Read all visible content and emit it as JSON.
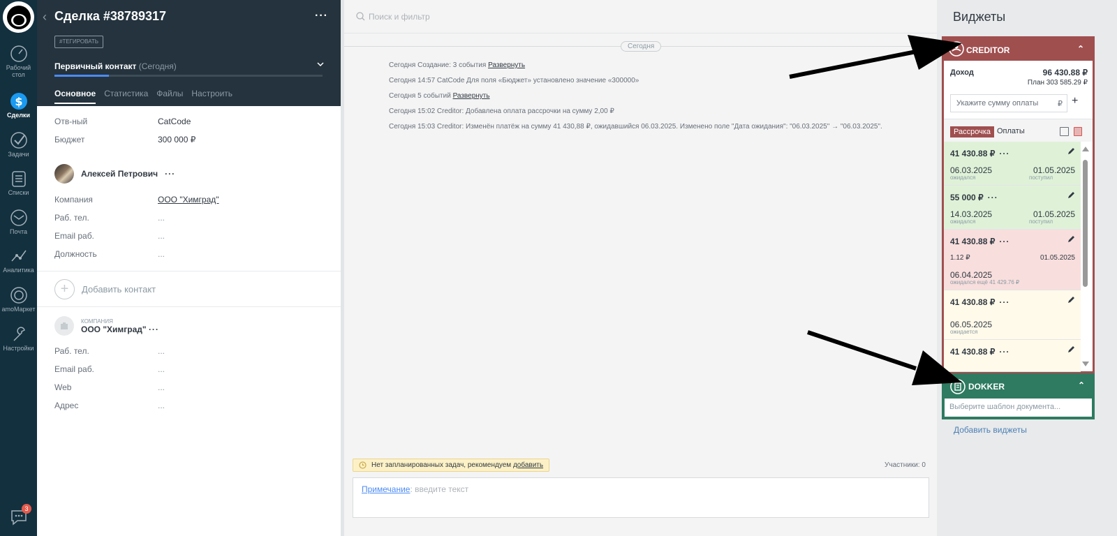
{
  "nav": {
    "items": [
      {
        "label": "Рабочий стол",
        "icon": "dashboard-icon"
      },
      {
        "label": "Сделки",
        "icon": "deals-icon"
      },
      {
        "label": "Задачи",
        "icon": "tasks-icon"
      },
      {
        "label": "Списки",
        "icon": "lists-icon"
      },
      {
        "label": "Почта",
        "icon": "mail-icon"
      },
      {
        "label": "Аналитика",
        "icon": "analytics-icon"
      },
      {
        "label": "amoМаркет",
        "icon": "market-icon"
      },
      {
        "label": "Настройки",
        "icon": "settings-icon"
      }
    ],
    "chat_badge": "3"
  },
  "deal": {
    "title": "Сделка #38789317",
    "tag_button": "#ТЕГИРОВАТЬ",
    "pipeline_stage": "Первичный контакт",
    "stage_date": "(Сегодня)",
    "tabs": [
      "Основное",
      "Статистика",
      "Файлы",
      "Настроить"
    ],
    "fields": [
      {
        "label": "Отв-ный",
        "value": "CatCode"
      },
      {
        "label": "Бюджет",
        "value": "300 000  ₽"
      }
    ],
    "contact": {
      "name": "Алексей Петрович",
      "fields": [
        {
          "label": "Компания",
          "value": "ООО \"Химград\""
        },
        {
          "label": "Раб. тел.",
          "value": "..."
        },
        {
          "label": "Email раб.",
          "value": "..."
        },
        {
          "label": "Должность",
          "value": "..."
        }
      ]
    },
    "add_contact": "Добавить контакт",
    "company": {
      "caption": "компания",
      "name": "ООО \"Химград\"",
      "fields": [
        {
          "label": "Раб. тел.",
          "value": "..."
        },
        {
          "label": "Email раб.",
          "value": "..."
        },
        {
          "label": "Web",
          "value": "..."
        },
        {
          "label": "Адрес",
          "value": "..."
        }
      ]
    }
  },
  "feed": {
    "search_placeholder": "Поиск и фильтр",
    "day_label": "Сегодня",
    "events": [
      {
        "text": "Сегодня Создание: 3 события ",
        "link": "Развернуть"
      },
      {
        "text": "Сегодня 14:57 CatCode Для поля «Бюджет» установлено значение «300000»",
        "link": ""
      },
      {
        "text": "Сегодня 5 событий ",
        "link": "Развернуть"
      },
      {
        "text": "Сегодня 15:02 Creditor: Добавлена оплата рассрочки на сумму 2,00 ₽",
        "link": ""
      },
      {
        "text": "Сегодня 15:03 Creditor: Изменён платёж на сумму 41 430,88 ₽, ожидавшийся 06.03.2025. Изменено поле \"Дата ожидания\": \"06.03.2025\" → \"06.03.2025\".",
        "link": ""
      }
    ],
    "no_tasks": "Нет запланированных задач, рекомендуем ",
    "no_tasks_link": "добавить",
    "participants": "Участники: 0",
    "note_link": "Примечание",
    "note_placeholder": ": введите текст"
  },
  "widgets": {
    "title": "Виджеты",
    "creditor": {
      "name": "CREDITOR",
      "income_label": "Доход",
      "income_value": "96 430.88 ₽",
      "plan": "План 303 585.29 ₽",
      "sum_placeholder": "Укажите сумму оплаты",
      "currency": "₽",
      "tab_active": "Рассрочка",
      "tab_other": "Оплаты",
      "payments": [
        {
          "amount": "41 430.88 ₽",
          "d1": "06.03.2025",
          "d1_sub": "ожидался",
          "d2": "01.05.2025",
          "d2_sub": "поступил",
          "status": "paid"
        },
        {
          "amount": "55 000 ₽",
          "d1": "14.03.2025",
          "d1_sub": "ожидался",
          "d2": "01.05.2025",
          "d2_sub": "поступил",
          "status": "paid"
        },
        {
          "amount": "41 430.88 ₽",
          "partial": "1.12 ₽",
          "partial_date": "01.05.2025",
          "d1": "06.04.2025",
          "d1_sub": "ожидался ещё 41 429.76 ₽",
          "status": "overdue"
        },
        {
          "amount": "41 430.88 ₽",
          "d1": "06.05.2025",
          "d1_sub": "ожидается",
          "status": "pending"
        },
        {
          "amount": "41 430.88 ₽",
          "status": "pending"
        }
      ]
    },
    "dokker": {
      "name": "DOKKER",
      "placeholder": "Выберите шаблон документа..."
    },
    "add_widgets": "Добавить виджеты"
  },
  "colors": {
    "sidebar": "#13303f",
    "card_header": "#24333e",
    "creditor": "#a04f4f",
    "dokker": "#2e7b61",
    "paid": "#dff2d8",
    "overdue": "#f8dedd",
    "pending": "#fffaea"
  }
}
